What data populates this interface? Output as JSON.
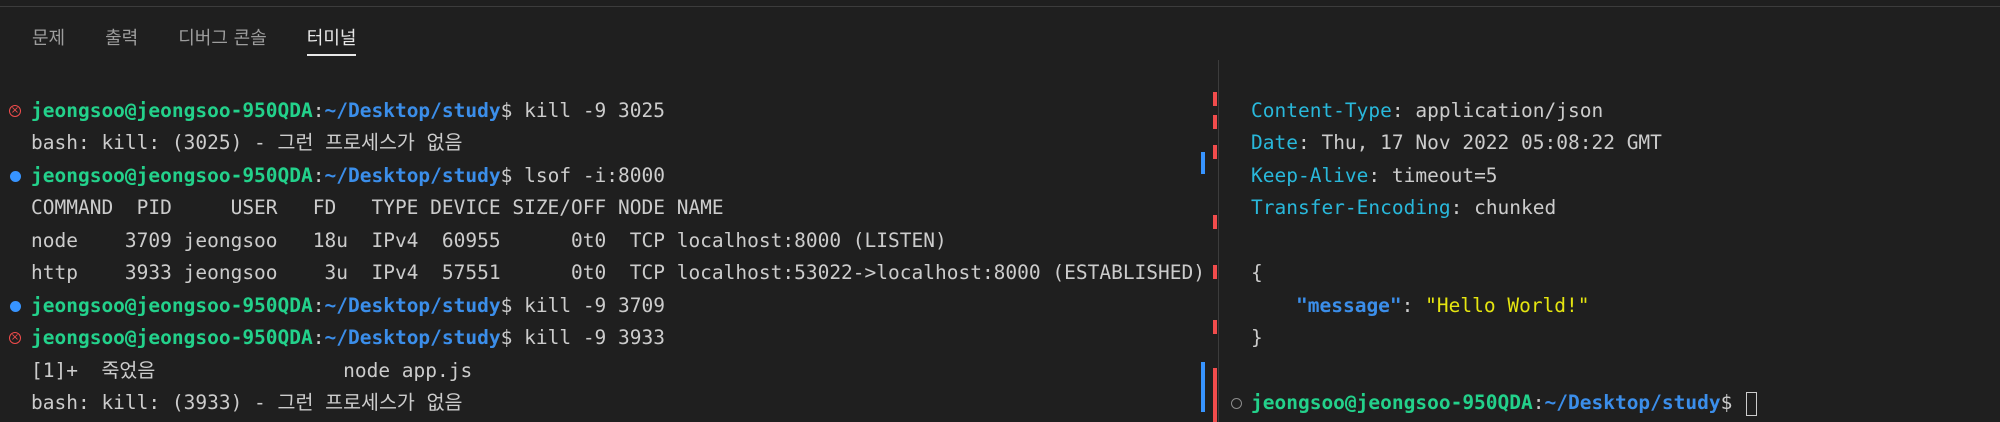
{
  "tabs": [
    {
      "label": "문제"
    },
    {
      "label": "출력"
    },
    {
      "label": "디버그 콘솔"
    },
    {
      "label": "터미널",
      "active": true
    }
  ],
  "prompt": {
    "user": "jeongsoo@jeongsoo-950QDA",
    "sep": ":",
    "path": "~/Desktop/study",
    "dollar": "$"
  },
  "left_terminal": {
    "cmd1": " kill -9 3025",
    "out1": "bash: kill: (3025) - 그런 프로세스가 없음",
    "cmd2": " lsof -i:8000",
    "header": "COMMAND  PID     USER   FD   TYPE DEVICE SIZE/OFF NODE NAME",
    "row1": "node    3709 jeongsoo   18u  IPv4  60955      0t0  TCP localhost:8000 (LISTEN)",
    "row2": "http    3933 jeongsoo    3u  IPv4  57551      0t0  TCP localhost:53022->localhost:8000 (ESTABLISHED)",
    "cmd3": " kill -9 3709",
    "cmd4": " kill -9 3933",
    "out2": "[1]+  죽었음                node app.js",
    "out3": "bash: kill: (3933) - 그런 프로세스가 없음"
  },
  "right_terminal": {
    "headers": [
      {
        "key": "Content-Type",
        "value": ": application/json"
      },
      {
        "key": "Date",
        "value": ": Thu, 17 Nov 2022 05:08:22 GMT"
      },
      {
        "key": "Keep-Alive",
        "value": ": timeout=5"
      },
      {
        "key": "Transfer-Encoding",
        "value": ": chunked"
      }
    ],
    "brace_open": "{",
    "json_key": "\"message\"",
    "json_colon": ": ",
    "json_value": "\"Hello World!\"",
    "brace_close": "}"
  },
  "colors": {
    "error": "#f14c4c",
    "success": "#3794ff",
    "user": "#23d18b",
    "path": "#3b8eea"
  }
}
